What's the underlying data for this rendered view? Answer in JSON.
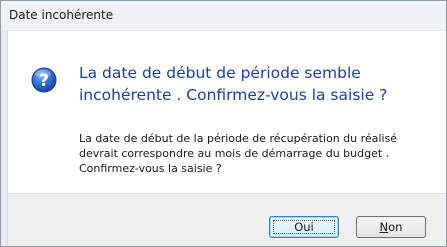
{
  "window": {
    "title": "Date incohérente"
  },
  "message": {
    "icon": "question-icon",
    "main_instruction_line1": "La date de début de période semble",
    "main_instruction_line2": "incohérente . Confirmez-vous la saisie ?",
    "body_line1": "La date de début de la période de récupération du réalisé",
    "body_line2": "devrait correspondre au mois de démarrage du budget .",
    "body_line3": "Confirmez-vous la saisie ?"
  },
  "buttons": {
    "oui_label": "Oui",
    "non_label_access_key": "N",
    "non_label_rest": "on"
  },
  "colors": {
    "instruction_text": "#1c3fa8",
    "icon_blue": "#2f6fd6",
    "default_button_border": "#3c7fb1"
  }
}
